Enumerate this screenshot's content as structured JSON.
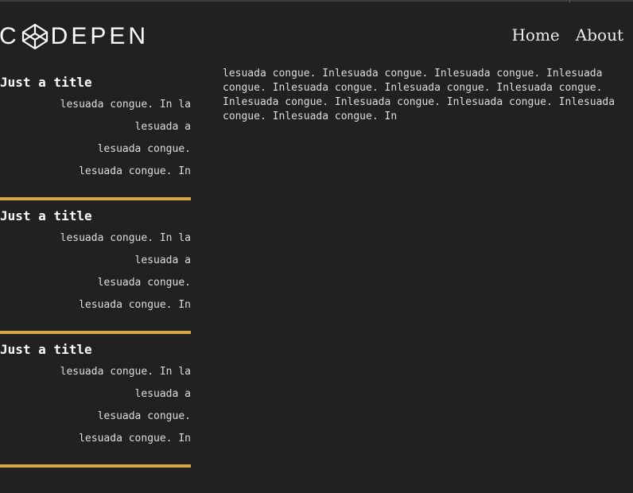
{
  "header": {
    "logo_text_pre": "C",
    "logo_text_post": "DEPEN",
    "nav": [
      {
        "label": "Home"
      },
      {
        "label": "About"
      }
    ]
  },
  "sidebar": {
    "cards": [
      {
        "title": "Just a title",
        "lines": [
          "lesuada congue. In la",
          "lesuada a",
          "lesuada congue.",
          "lesuada congue. In"
        ]
      },
      {
        "title": "Just a title",
        "lines": [
          "lesuada congue. In la",
          "lesuada a",
          "lesuada congue.",
          "lesuada congue. In"
        ]
      },
      {
        "title": "Just a title",
        "lines": [
          "lesuada congue. In la",
          "lesuada a",
          "lesuada congue.",
          "lesuada congue. In"
        ]
      }
    ]
  },
  "main": {
    "text": "lesuada congue. Inlesuada congue. Inlesuada congue. Inlesuada congue. Inlesuada congue. Inlesuada congue. Inlesuada congue. Inlesuada congue. Inlesuada congue. Inlesuada congue. Inlesuada congue. Inlesuada congue. In"
  },
  "colors": {
    "background": "#212121",
    "accent_rule": "#d4a849",
    "text": "#eeeeee"
  }
}
